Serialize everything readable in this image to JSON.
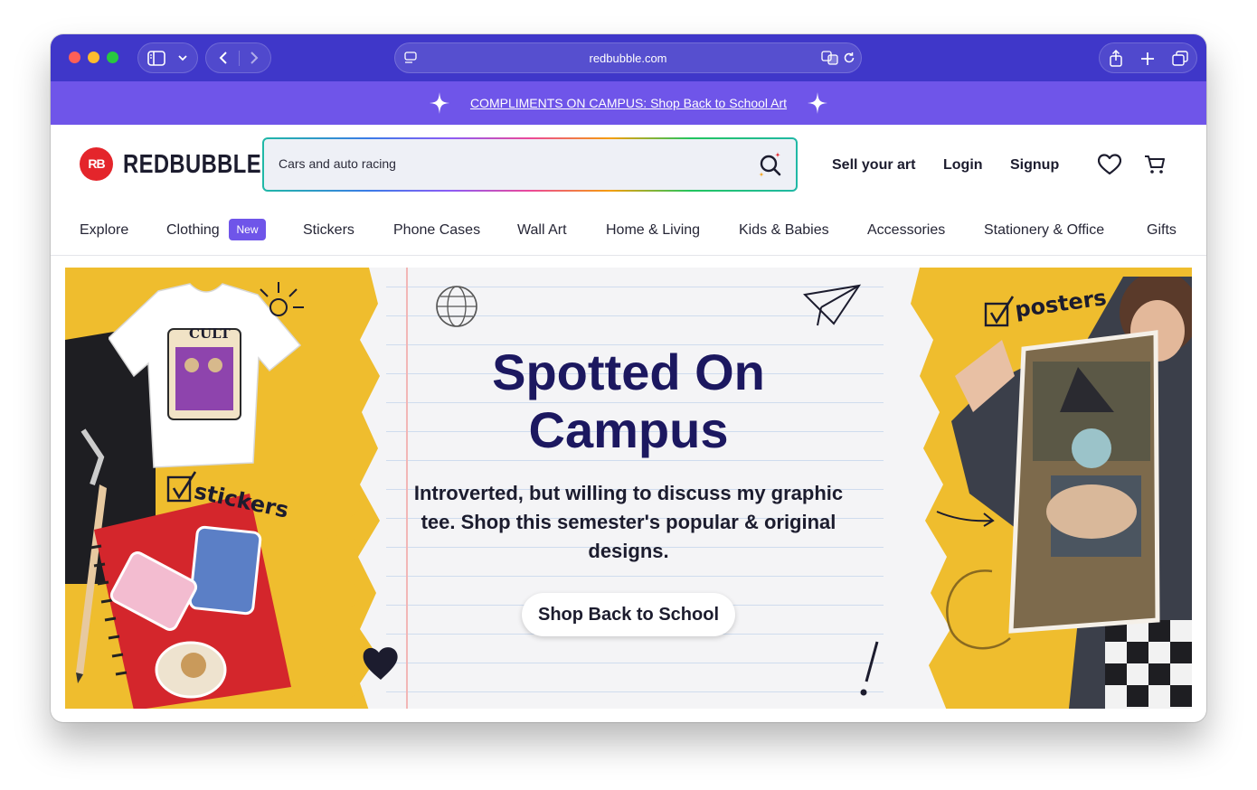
{
  "browser": {
    "url": "redbubble.com",
    "icons": [
      "sidebar-icon",
      "chevron-down-icon",
      "back-icon",
      "forward-icon",
      "reader-icon",
      "translate-icon",
      "reload-icon",
      "share-icon",
      "new-tab-icon",
      "tabs-overview-icon"
    ]
  },
  "promo": {
    "text": "COMPLIMENTS ON CAMPUS: Shop Back to School Art"
  },
  "header": {
    "logo_mark": "RB",
    "logo_text": "REDBUBBLE",
    "search_value": "Cars and auto racing",
    "links": {
      "sell": "Sell your art",
      "login": "Login",
      "signup": "Signup"
    },
    "icons": [
      "search-icon",
      "heart-icon",
      "cart-icon"
    ]
  },
  "nav": {
    "items": [
      "Explore",
      "Clothing",
      "Stickers",
      "Phone Cases",
      "Wall Art",
      "Home & Living",
      "Kids & Babies",
      "Accessories",
      "Stationery & Office",
      "Gifts"
    ],
    "badge": "New"
  },
  "hero": {
    "title": "Spotted On Campus",
    "subtitle": "Introverted, but willing to discuss my graphic tee. Shop this semester's popular & original designs.",
    "cta": "Shop Back to School",
    "doodles": {
      "stickers": "stickers",
      "posters": "posters"
    },
    "colors": {
      "background": "#efbd2e",
      "title": "#1c1860"
    }
  },
  "colors": {
    "toolbar": "#3f37c9",
    "promo": "#6f55e9",
    "brand_red": "#e4252b"
  }
}
